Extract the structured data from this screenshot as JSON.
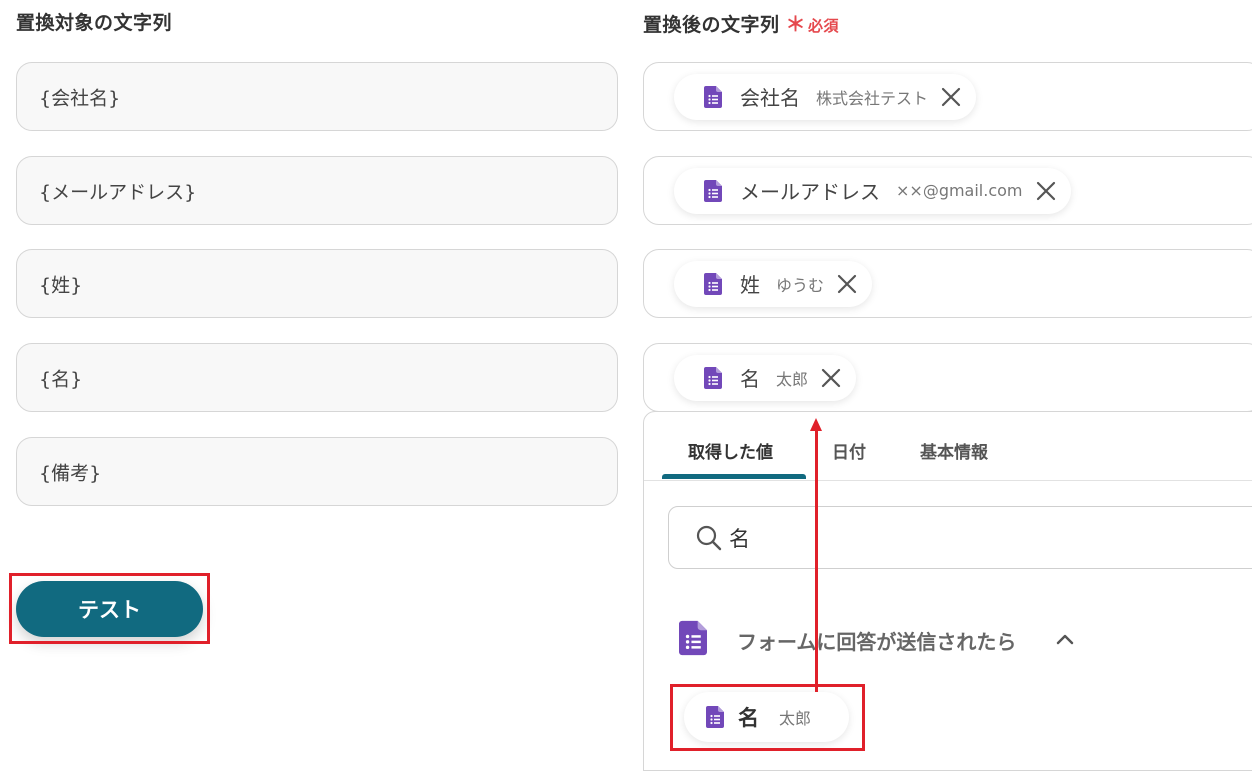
{
  "left_column": {
    "title": "置換対象の文字列",
    "fields": [
      {
        "value": "{会社名}"
      },
      {
        "value": "{メールアドレス}"
      },
      {
        "value": "{姓}"
      },
      {
        "value": "{名}"
      },
      {
        "value": "{備考}"
      }
    ],
    "test_button": "テスト"
  },
  "right_column": {
    "title": "置換後の文字列",
    "required_mark": "＊",
    "required_text": "必須",
    "fields": [
      {
        "name": "会社名",
        "value": "株式会社テスト"
      },
      {
        "name": "メールアドレス",
        "value": "××@gmail.com"
      },
      {
        "name": "姓",
        "value": "ゆうむ"
      },
      {
        "name": "名",
        "value": "太郎"
      }
    ]
  },
  "dropdown": {
    "tabs": [
      {
        "label": "取得した値",
        "active": true
      },
      {
        "label": "日付",
        "active": false
      },
      {
        "label": "基本情報",
        "active": false
      }
    ],
    "search_value": "名",
    "group_label": "フォームに回答が送信されたら",
    "option": {
      "name": "名",
      "value": "太郎"
    }
  },
  "colors": {
    "primary": "#116a80",
    "highlight_red": "#e0202a",
    "required_red": "#e5484d",
    "forms_purple": "#7248b9"
  },
  "icons": {
    "chip_icon": "google-forms-icon",
    "remove_icon": "close-icon",
    "search_icon": "search-icon",
    "expand_icon": "chevron-up-icon"
  }
}
